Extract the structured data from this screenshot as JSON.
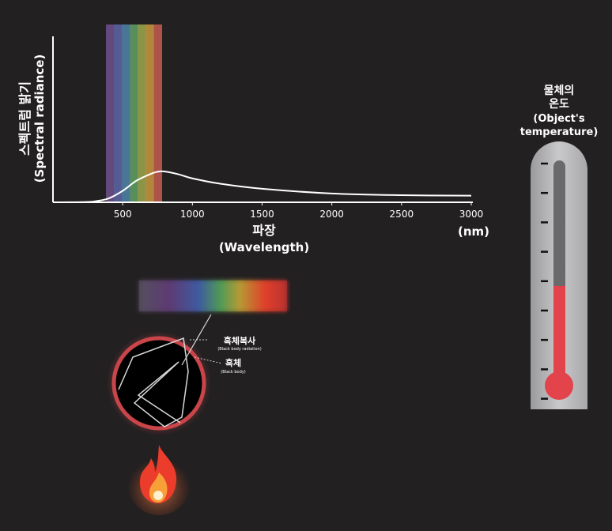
{
  "chart_data": {
    "type": "line",
    "ylabel": "스펙트럼 밝기",
    "ylabel_en": "(Spectral radiance)",
    "xlabel": "파장",
    "xlabel_en": "(Wavelength)",
    "x_unit": "(nm)",
    "x_ticks": [
      "500",
      "1000",
      "1500",
      "2000",
      "2500",
      "3000"
    ],
    "xlim": [
      0,
      3000
    ],
    "visible_band_nm": [
      380,
      780
    ],
    "band_colors": [
      "#6a4e86",
      "#5a63a0",
      "#4f7fa3",
      "#5e9a63",
      "#98a24a",
      "#c3923e",
      "#bb5a4f"
    ],
    "series": [
      {
        "x": [
          0,
          200,
          300,
          400,
          500,
          600,
          700,
          750,
          800,
          900,
          1000,
          1200,
          1500,
          2000,
          2500,
          3000
        ],
        "y": [
          0,
          0.1,
          0.6,
          2.5,
          7.3,
          13.8,
          18.0,
          19.4,
          19.6,
          17.8,
          15.2,
          11.8,
          8.6,
          5.6,
          4.5,
          4.2
        ]
      }
    ],
    "grid": false
  },
  "labels": {
    "temp_title": "물체의",
    "temp_title2": "온도",
    "temp_en1": "(Object's",
    "temp_en2": "temperature)",
    "black_body_radiation": "흑체복사",
    "black_body_radiation_en": "(Black body radiation)",
    "black_body": "흑체",
    "black_body_en": "(Black body)"
  },
  "thermometer": {
    "level_fraction": 0.45,
    "fill_color": "#e3434a"
  },
  "colors": {
    "background": "#232021",
    "curve": "#ffffff",
    "ring": "#c8454a"
  },
  "icons": {
    "flame": "fire-icon",
    "thermometer": "thermometer-icon",
    "body": "black-body-icon"
  }
}
